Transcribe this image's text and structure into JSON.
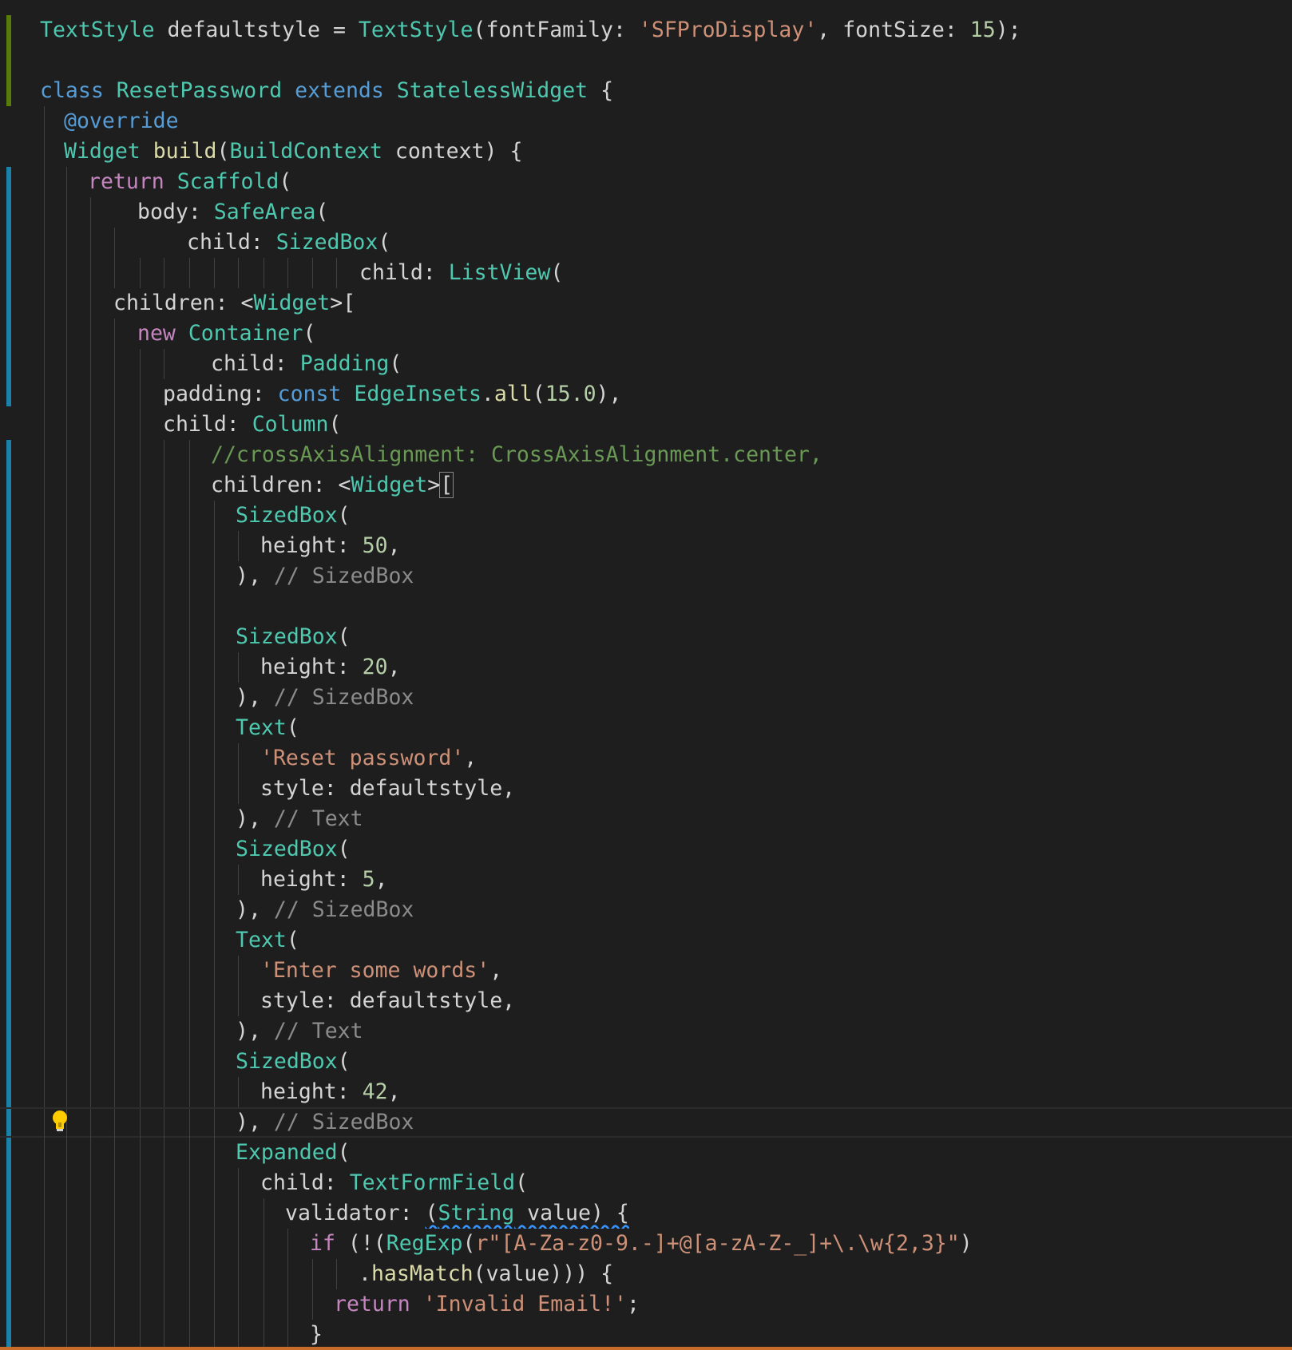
{
  "theme": {
    "background": "#1e1e1e",
    "type_color": "#4ec9b0",
    "keyword_color": "#569cd6",
    "control_color": "#c586c0",
    "function_color": "#dcdcaa",
    "string_color": "#ce9178",
    "number_color": "#b5cea8",
    "comment_color": "#6a9955",
    "modified_bar_color": "#1b81a8",
    "added_bar_color": "#587c0c"
  },
  "code_lines": [
    {
      "tokens": [
        [
          "type",
          "TextStyle"
        ],
        [
          "var",
          " defaultstyle = "
        ],
        [
          "type",
          "TextStyle"
        ],
        [
          "punct",
          "("
        ],
        [
          "prop",
          "fontFamily"
        ],
        [
          "punct",
          ": "
        ],
        [
          "str",
          "'SFProDisplay'"
        ],
        [
          "punct",
          ", "
        ],
        [
          "prop",
          "fontSize"
        ],
        [
          "punct",
          ": "
        ],
        [
          "num",
          "15"
        ],
        [
          "punct",
          ");"
        ]
      ]
    },
    {
      "tokens": []
    },
    {
      "tokens": [
        [
          "kw",
          "class"
        ],
        [
          "var",
          " "
        ],
        [
          "type",
          "ResetPassword"
        ],
        [
          "var",
          " "
        ],
        [
          "kw",
          "extends"
        ],
        [
          "var",
          " "
        ],
        [
          "type",
          "StatelessWidget"
        ],
        [
          "punct",
          " {"
        ]
      ]
    },
    {
      "tokens": [
        [
          "kw",
          "@override"
        ]
      ]
    },
    {
      "tokens": [
        [
          "type",
          "Widget"
        ],
        [
          "var",
          " "
        ],
        [
          "fn",
          "build"
        ],
        [
          "punct",
          "("
        ],
        [
          "type",
          "BuildContext"
        ],
        [
          "var",
          " context"
        ],
        [
          "punct",
          ") {"
        ]
      ]
    },
    {
      "tokens": [
        [
          "ctrl",
          "return"
        ],
        [
          "var",
          " "
        ],
        [
          "type",
          "Scaffold"
        ],
        [
          "punct",
          "("
        ]
      ]
    },
    {
      "tokens": [
        [
          "prop",
          "body"
        ],
        [
          "punct",
          ": "
        ],
        [
          "type",
          "SafeArea"
        ],
        [
          "punct",
          "("
        ]
      ]
    },
    {
      "tokens": [
        [
          "prop",
          "child"
        ],
        [
          "punct",
          ": "
        ],
        [
          "type",
          "SizedBox"
        ],
        [
          "punct",
          "("
        ]
      ]
    },
    {
      "tokens": [
        [
          "prop",
          "child"
        ],
        [
          "punct",
          ": "
        ],
        [
          "type",
          "ListView"
        ],
        [
          "punct",
          "("
        ]
      ]
    },
    {
      "tokens": [
        [
          "prop",
          "children"
        ],
        [
          "punct",
          ": <"
        ],
        [
          "type",
          "Widget"
        ],
        [
          "punct",
          ">["
        ]
      ]
    },
    {
      "tokens": [
        [
          "ctrl",
          "new"
        ],
        [
          "var",
          " "
        ],
        [
          "type",
          "Container"
        ],
        [
          "punct",
          "("
        ]
      ]
    },
    {
      "tokens": [
        [
          "prop",
          "child"
        ],
        [
          "punct",
          ": "
        ],
        [
          "type",
          "Padding"
        ],
        [
          "punct",
          "("
        ]
      ]
    },
    {
      "tokens": [
        [
          "prop",
          "padding"
        ],
        [
          "punct",
          ": "
        ],
        [
          "kw",
          "const"
        ],
        [
          "var",
          " "
        ],
        [
          "type",
          "EdgeInsets"
        ],
        [
          "punct",
          "."
        ],
        [
          "fn",
          "all"
        ],
        [
          "punct",
          "("
        ],
        [
          "num",
          "15.0"
        ],
        [
          "punct",
          "),"
        ]
      ]
    },
    {
      "tokens": [
        [
          "prop",
          "child"
        ],
        [
          "punct",
          ": "
        ],
        [
          "type",
          "Column"
        ],
        [
          "punct",
          "("
        ]
      ]
    },
    {
      "tokens": [
        [
          "cmt",
          "//crossAxisAlignment: CrossAxisAlignment.center,"
        ]
      ]
    },
    {
      "tokens": [
        [
          "prop",
          "children"
        ],
        [
          "punct",
          ": <"
        ],
        [
          "type",
          "Widget"
        ],
        [
          "punct",
          ">"
        ],
        [
          "box",
          "["
        ]
      ]
    },
    {
      "tokens": [
        [
          "type",
          "SizedBox"
        ],
        [
          "punct",
          "("
        ]
      ]
    },
    {
      "tokens": [
        [
          "prop",
          "height"
        ],
        [
          "punct",
          ": "
        ],
        [
          "num",
          "50"
        ],
        [
          "punct",
          ","
        ]
      ]
    },
    {
      "tokens": [
        [
          "punct",
          "), "
        ],
        [
          "cmt2",
          "// SizedBox"
        ]
      ]
    },
    {
      "tokens": []
    },
    {
      "tokens": [
        [
          "type",
          "SizedBox"
        ],
        [
          "punct",
          "("
        ]
      ]
    },
    {
      "tokens": [
        [
          "prop",
          "height"
        ],
        [
          "punct",
          ": "
        ],
        [
          "num",
          "20"
        ],
        [
          "punct",
          ","
        ]
      ]
    },
    {
      "tokens": [
        [
          "punct",
          "), "
        ],
        [
          "cmt2",
          "// SizedBox"
        ]
      ]
    },
    {
      "tokens": [
        [
          "type",
          "Text"
        ],
        [
          "punct",
          "("
        ]
      ]
    },
    {
      "tokens": [
        [
          "str",
          "'Reset password'"
        ],
        [
          "punct",
          ","
        ]
      ]
    },
    {
      "tokens": [
        [
          "prop",
          "style"
        ],
        [
          "punct",
          ": "
        ],
        [
          "var",
          "defaultstyle"
        ],
        [
          "punct",
          ","
        ]
      ]
    },
    {
      "tokens": [
        [
          "punct",
          "), "
        ],
        [
          "cmt2",
          "// Text"
        ]
      ]
    },
    {
      "tokens": [
        [
          "type",
          "SizedBox"
        ],
        [
          "punct",
          "("
        ]
      ]
    },
    {
      "tokens": [
        [
          "prop",
          "height"
        ],
        [
          "punct",
          ": "
        ],
        [
          "num",
          "5"
        ],
        [
          "punct",
          ","
        ]
      ]
    },
    {
      "tokens": [
        [
          "punct",
          "), "
        ],
        [
          "cmt2",
          "// SizedBox"
        ]
      ]
    },
    {
      "tokens": [
        [
          "type",
          "Text"
        ],
        [
          "punct",
          "("
        ]
      ]
    },
    {
      "tokens": [
        [
          "str",
          "'Enter some words'"
        ],
        [
          "punct",
          ","
        ]
      ]
    },
    {
      "tokens": [
        [
          "prop",
          "style"
        ],
        [
          "punct",
          ": "
        ],
        [
          "var",
          "defaultstyle"
        ],
        [
          "punct",
          ","
        ]
      ]
    },
    {
      "tokens": [
        [
          "punct",
          "), "
        ],
        [
          "cmt2",
          "// Text"
        ]
      ]
    },
    {
      "tokens": [
        [
          "type",
          "SizedBox"
        ],
        [
          "punct",
          "("
        ]
      ]
    },
    {
      "tokens": [
        [
          "prop",
          "height"
        ],
        [
          "punct",
          ": "
        ],
        [
          "num",
          "42"
        ],
        [
          "punct",
          ","
        ]
      ]
    },
    {
      "tokens": [
        [
          "punct",
          "), "
        ],
        [
          "cmt2",
          "// SizedBox"
        ]
      ]
    },
    {
      "tokens": [
        [
          "type",
          "Expanded"
        ],
        [
          "punct",
          "("
        ]
      ]
    },
    {
      "tokens": [
        [
          "prop",
          "child"
        ],
        [
          "punct",
          ": "
        ],
        [
          "type",
          "TextFormField"
        ],
        [
          "punct",
          "("
        ]
      ]
    },
    {
      "tokens": [
        [
          "prop",
          "validator"
        ],
        [
          "punct",
          ": "
        ],
        [
          "sq",
          "("
        ],
        [
          "sqt",
          "String"
        ],
        [
          "sq",
          " value) {"
        ]
      ]
    },
    {
      "tokens": [
        [
          "ctrl",
          "if"
        ],
        [
          "punct",
          " (!("
        ],
        [
          "type",
          "RegExp"
        ],
        [
          "punct",
          "("
        ],
        [
          "str",
          "r\"[A-Za-z0-9.-]+@[a-zA-Z-_]+\\.\\w{2,3}\""
        ],
        [
          "punct",
          ")"
        ]
      ]
    },
    {
      "tokens": [
        [
          "punct",
          "."
        ],
        [
          "fn",
          "hasMatch"
        ],
        [
          "punct",
          "(value))) {"
        ]
      ]
    },
    {
      "tokens": [
        [
          "ctrl",
          "return"
        ],
        [
          "var",
          " "
        ],
        [
          "str",
          "'Invalid Email!'"
        ],
        [
          "punct",
          ";"
        ]
      ]
    },
    {
      "tokens": [
        [
          "punct",
          "}"
        ]
      ]
    }
  ]
}
